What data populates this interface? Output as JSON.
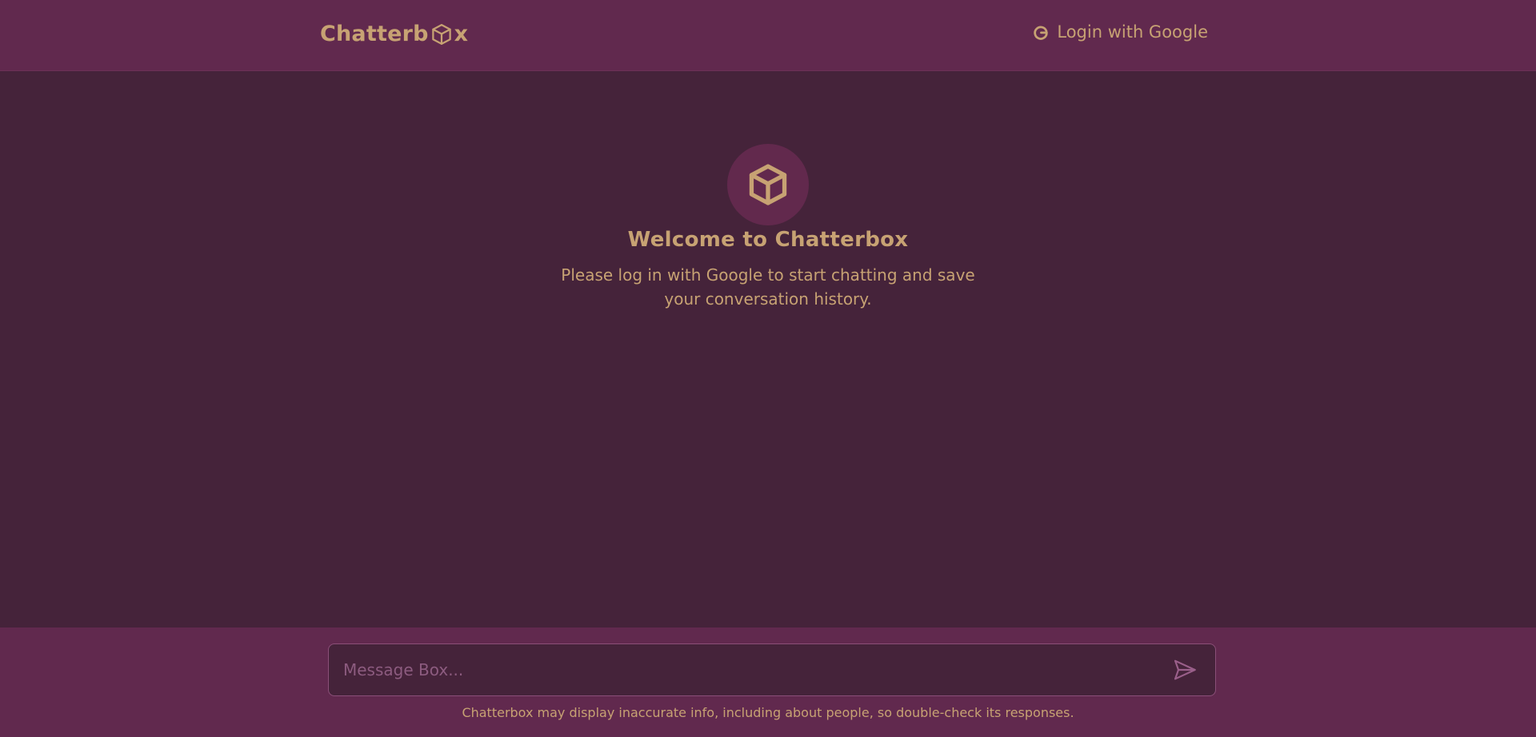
{
  "header": {
    "brand_prefix": "Chatterb",
    "brand_suffix": "x",
    "brand_icon": "cube-icon",
    "login_label": "Login with Google",
    "login_icon": "google-g-icon"
  },
  "welcome": {
    "icon": "cube-icon",
    "title": "Welcome to Chatterbox",
    "subtitle": "Please log in with Google to start chatting and save your conversation history."
  },
  "composer": {
    "placeholder": "Message Box...",
    "send_icon": "send-icon",
    "disclaimer": "Chatterbox may display inaccurate info, including about people, so double-check its responses."
  },
  "colors": {
    "background": "#45233a",
    "bar": "#61294e",
    "accent": "#c7a273",
    "muted": "#8c5b7f"
  }
}
